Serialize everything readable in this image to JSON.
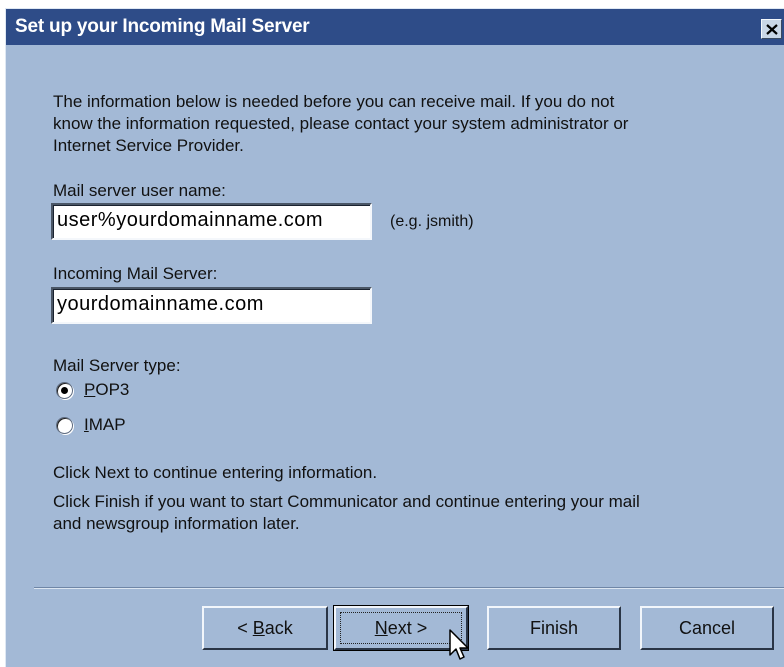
{
  "window": {
    "title": "Set up your Incoming Mail Server",
    "close_icon": "close-icon"
  },
  "intro_text": "The information below is needed before you can receive mail.  If you do not know the information requested, please contact your system administrator or Internet Service Provider.",
  "fields": {
    "username_label": "Mail server user name:",
    "username_value": "user%yourdomainname.com",
    "username_hint": "(e.g. jsmith)",
    "server_label": "Incoming Mail Server:",
    "server_value": "yourdomainname.com"
  },
  "server_type": {
    "label": "Mail Server type:",
    "options": [
      {
        "label": "POP3",
        "selected": true
      },
      {
        "label": "IMAP",
        "selected": false
      }
    ]
  },
  "footer_text": {
    "line1": "Click Next to continue entering information.",
    "line2": "Click Finish if you want to start Communicator and continue entering your mail and newsgroup information later."
  },
  "buttons": {
    "back": "< Back",
    "next": "Next >",
    "finish": "Finish",
    "cancel": "Cancel"
  },
  "colors": {
    "dialog_bg": "#a3b9d6",
    "titlebar_bg": "#2e4c88"
  }
}
